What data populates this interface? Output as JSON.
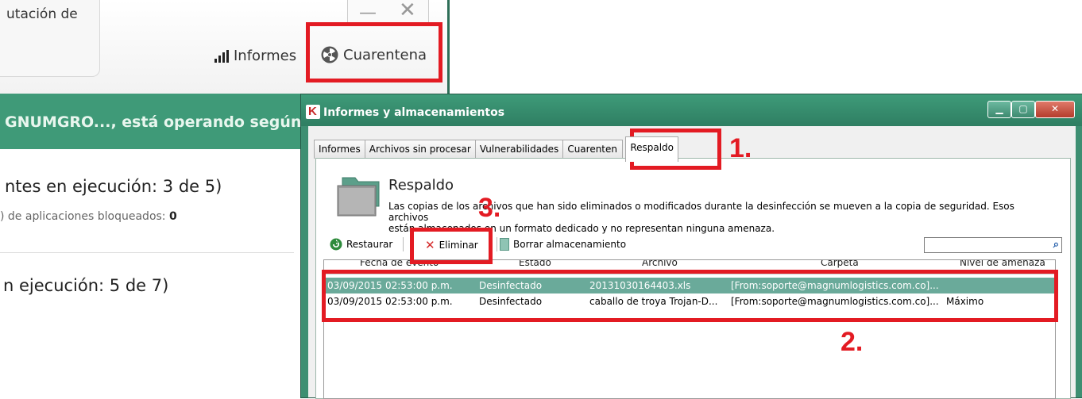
{
  "background_window": {
    "reputation_text": "utación de",
    "menu": {
      "informes_label": "Informes",
      "cuarentena_label": "Cuarentena"
    },
    "status_banner": "GNUMGRO..., está operando según u",
    "components_running": "ntes en ejecución: 3 de 5)",
    "blocked_apps_label": ") de aplicaciones bloqueados: ",
    "blocked_apps_count": "0",
    "tasks_running": "n ejecución: 5 de 7)"
  },
  "dialog": {
    "title": "Informes y almacenamientos",
    "tabs": [
      {
        "label": "Informes",
        "active": false
      },
      {
        "label": "Archivos sin procesar",
        "active": false
      },
      {
        "label": "Vulnerabilidades",
        "active": false
      },
      {
        "label": "Cuarenten",
        "active": false
      },
      {
        "label": "Respaldo",
        "active": true
      }
    ],
    "section_title": "Respaldo",
    "description_line1": "Las copias de los archivos que han sido eliminados o modificados durante la desinfección se mueven a la copia de seguridad. Esos archivos",
    "description_line2": "están almacenados en un formato dedicado y no representan ninguna amenaza.",
    "toolbar": {
      "restore_label": "Restaurar",
      "delete_label": "Eliminar",
      "clear_label": "Borrar almacenamiento",
      "search_value": ""
    },
    "columns": [
      "Fecha de evento",
      "Estado",
      "Archivo",
      "Carpeta",
      "Nivel de amenaza"
    ],
    "rows": [
      {
        "date": "03/09/2015 02:53:00 p.m.",
        "status": "Desinfectado",
        "file": "20131030164403.xls",
        "folder": "[From:soporte@magnumlogistics.com.co]...",
        "threat": "",
        "selected": true
      },
      {
        "date": "03/09/2015 02:53:00 p.m.",
        "status": "Desinfectado",
        "file": "caballo de troya Trojan-D...",
        "folder": "[From:soporte@magnumlogistics.com.co]...",
        "threat": "Máximo",
        "selected": false
      }
    ]
  },
  "annotations": {
    "n1": "1.",
    "n2": "2.",
    "n3": "3.",
    "color": "#e31b23"
  },
  "colors": {
    "kaspersky_green": "#3f9a78",
    "selection": "#6aaa9a"
  }
}
